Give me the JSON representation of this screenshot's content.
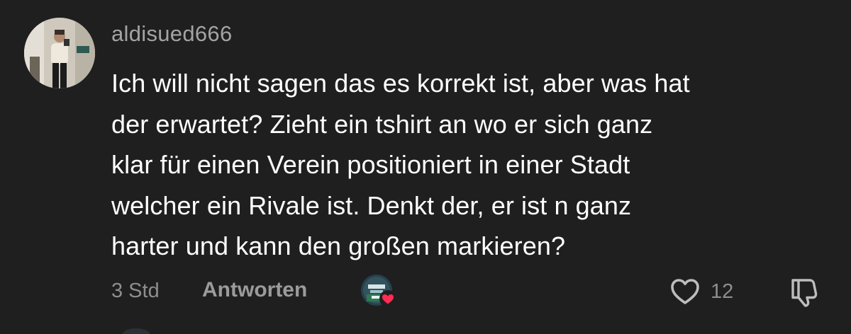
{
  "comment": {
    "username": "aldisued666",
    "text_lines": [
      "Ich will nicht sagen das es korrekt ist, aber was hat",
      "der erwartet? Zieht ein tshirt an wo er sich ganz",
      "klar für einen Verein positioniert in einer Stadt",
      "welcher ein Rivale ist. Denkt der, er ist n ganz",
      "harter und kann den großen markieren?"
    ],
    "timestamp": "3 Std",
    "reply_label": "Antworten",
    "like_count": "12"
  },
  "icons": {
    "like": "heart-outline-icon",
    "dislike": "thumbs-down-icon",
    "creator_liked": "heart-filled-icon"
  },
  "colors": {
    "background": "#1f1f1f",
    "text": "#ffffff",
    "secondary_text": "#8e8e8e",
    "heart_accent": "#fe2c55"
  }
}
